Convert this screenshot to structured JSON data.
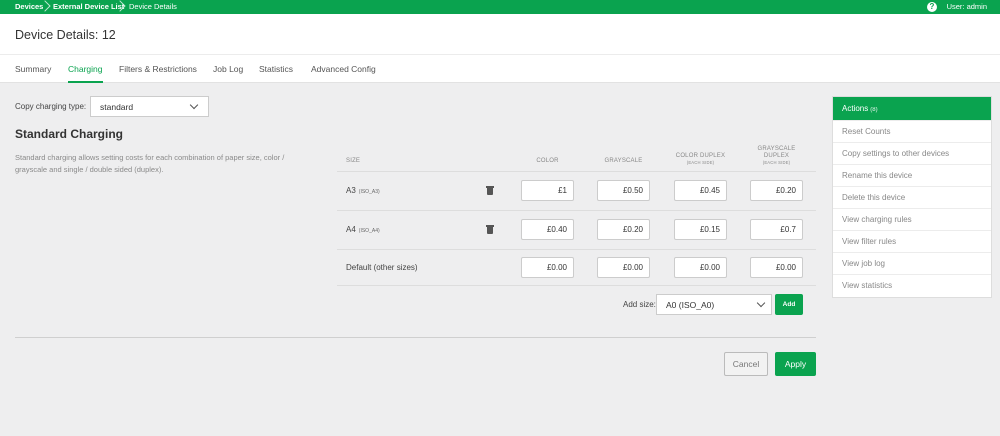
{
  "breadcrumb": [
    "Devices",
    "External Device List",
    "Device Details"
  ],
  "user": {
    "label": "User: admin"
  },
  "page": {
    "title": "Device Details: 12"
  },
  "tabs": [
    {
      "label": "Summary"
    },
    {
      "label": "Charging"
    },
    {
      "label": "Filters & Restrictions"
    },
    {
      "label": "Job Log"
    },
    {
      "label": "Statistics"
    },
    {
      "label": "Advanced Config"
    }
  ],
  "copy_charging": {
    "label": "Copy charging type:",
    "value": "standard"
  },
  "section": {
    "title": "Standard Charging",
    "description": "Standard charging allows setting costs for each combination of paper size, color / grayscale and single / double sided (duplex)."
  },
  "table": {
    "headers": {
      "size": "SIZE",
      "color": "COLOR",
      "grayscale": "GRAYSCALE",
      "color_duplex": "COLOR DUPLEX",
      "color_duplex_sub": "(EACH SIDE)",
      "gray_duplex_1": "GRAYSCALE",
      "gray_duplex_2": "DUPLEX",
      "gray_duplex_sub": "(EACH SIDE)"
    },
    "rows": [
      {
        "name": "A3",
        "code": "(ISO_A3)",
        "color": "£1",
        "grayscale": "£0.50",
        "color_duplex": "£0.45",
        "gray_duplex": "£0.20"
      },
      {
        "name": "A4",
        "code": "(ISO_A4)",
        "color": "£0.40",
        "grayscale": "£0.20",
        "color_duplex": "£0.15",
        "gray_duplex": "£0.7"
      },
      {
        "name": "Default (other sizes)",
        "code": "",
        "color": "£0.00",
        "grayscale": "£0.00",
        "color_duplex": "£0.00",
        "gray_duplex": "£0.00"
      }
    ]
  },
  "add_size": {
    "label": "Add size:",
    "value": "A0 (ISO_A0)",
    "button": "Add"
  },
  "buttons": {
    "cancel": "Cancel",
    "apply": "Apply"
  },
  "actions": {
    "title": "Actions",
    "count": "(8)",
    "items": [
      {
        "label": "Reset Counts"
      },
      {
        "label": "Copy settings to other devices"
      },
      {
        "label": "Rename this device"
      },
      {
        "label": "Delete this device"
      },
      {
        "label": "View charging rules"
      },
      {
        "label": "View filter rules"
      },
      {
        "label": "View job log"
      },
      {
        "label": "View statistics"
      }
    ]
  },
  "colors": {
    "accent": "#0aa34f",
    "background": "#eeeeef"
  }
}
